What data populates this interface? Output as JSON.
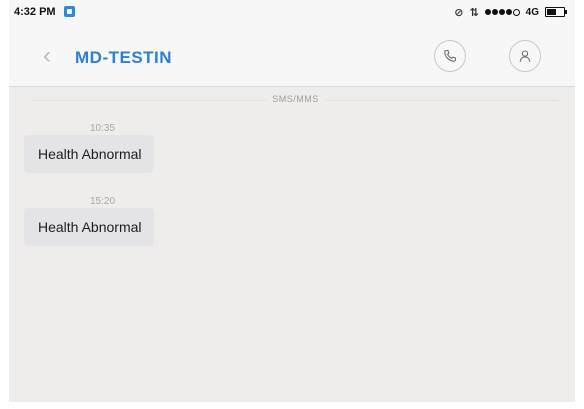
{
  "status_bar": {
    "time": "4:32 PM",
    "network": "4G"
  },
  "header": {
    "contact_name": "MD-TESTIN",
    "icons": [
      "back-chevron-icon",
      "phone-icon",
      "person-icon"
    ]
  },
  "conversation": {
    "label": "SMS/MMS",
    "messages": [
      {
        "time": "10:35",
        "text": "Health Abnormal"
      },
      {
        "time": "15:20",
        "text": "Health Abnormal"
      }
    ]
  },
  "colors": {
    "accent": "#2b7fd6",
    "background": "#efedeb",
    "bubble": "#e4e3e6"
  }
}
